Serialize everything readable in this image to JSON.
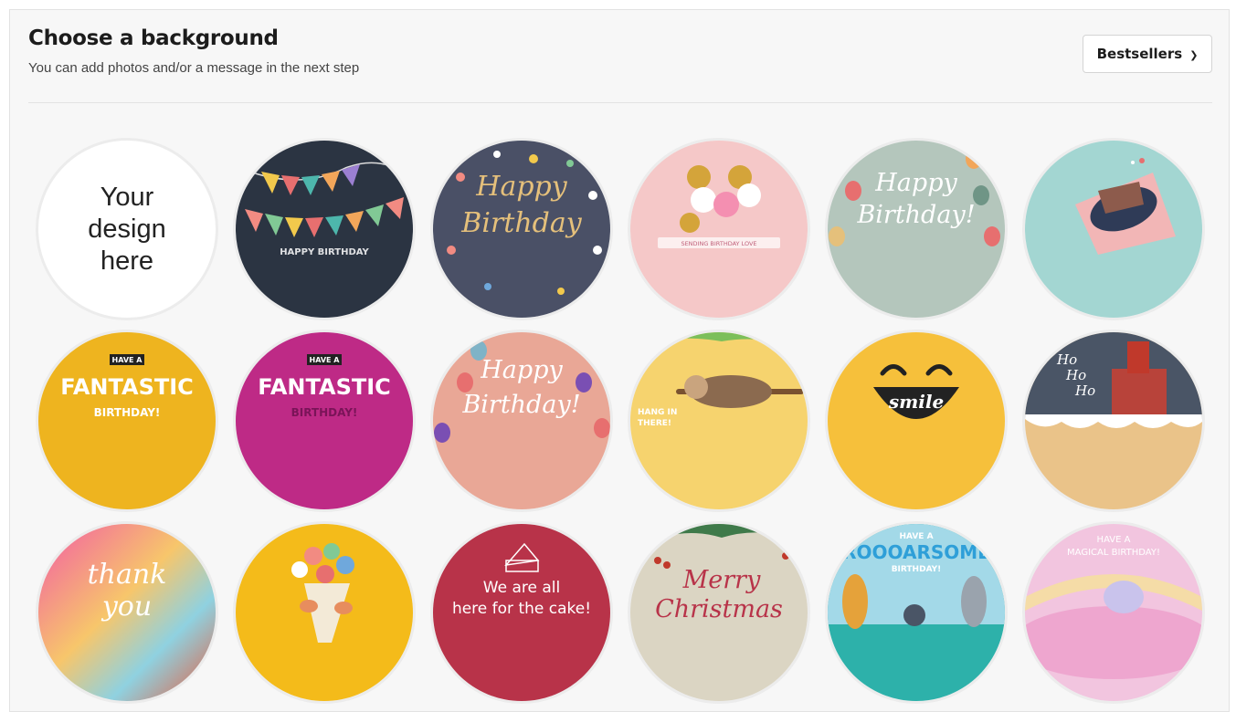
{
  "header": {
    "title": "Choose a background",
    "subtitle": "You can add photos and/or a message in the next step"
  },
  "sort": {
    "selected": "Bestsellers",
    "icon": "chevron-down-icon"
  },
  "designs": [
    {
      "id": "your-design",
      "lines": [
        "Your design",
        "here"
      ]
    },
    {
      "id": "happy-birthday-bunting",
      "text": "HAPPY BIRTHDAY",
      "color": "#2b3442"
    },
    {
      "id": "happy-birthday-navy",
      "lines": [
        "Happy",
        "Birthday"
      ],
      "color": "#4a5066"
    },
    {
      "id": "sending-birthday-love",
      "text": "SENDING BIRTHDAY LOVE",
      "color": "#f5c8c8"
    },
    {
      "id": "happy-birthday-sage",
      "lines": [
        "Happy",
        "Birthday!"
      ],
      "color": "#b4c6bc"
    },
    {
      "id": "cake-slice",
      "color": "#a3d6d2"
    },
    {
      "id": "fantastic-birthday-yellow",
      "lines": [
        "HAVE A",
        "FANTASTIC",
        "BIRTHDAY!"
      ],
      "color": "#eeb41f"
    },
    {
      "id": "fantastic-birthday-magenta",
      "lines": [
        "HAVE A",
        "FANTASTIC",
        "BIRTHDAY!"
      ],
      "color": "#be2a86"
    },
    {
      "id": "happy-birthday-peach",
      "lines": [
        "Happy",
        "Birthday!"
      ],
      "color": "#e9a796"
    },
    {
      "id": "hang-in-there-sloth",
      "lines": [
        "HANG IN",
        "THERE!"
      ],
      "color": "#f6d36e"
    },
    {
      "id": "smile",
      "text": "smile",
      "color": "#f6c03b"
    },
    {
      "id": "ho-ho-ho",
      "lines": [
        "Ho",
        "Ho",
        "Ho"
      ],
      "color": "#eac389"
    },
    {
      "id": "thank-you",
      "lines": [
        "thank",
        "you"
      ],
      "color": "#e8738c"
    },
    {
      "id": "flower-bouquet",
      "color": "#f4bb1a"
    },
    {
      "id": "here-for-the-cake",
      "lines": [
        "We are all",
        "here for the cake!"
      ],
      "color": "#b83349"
    },
    {
      "id": "merry-christmas",
      "lines": [
        "Merry",
        "Christmas"
      ],
      "color": "#dbd5c3"
    },
    {
      "id": "rooarsome-birthday",
      "lines": [
        "HAVE A",
        "ROOOARSOME",
        "BIRTHDAY!"
      ],
      "color": "#2db1aa"
    },
    {
      "id": "magical-birthday",
      "lines": [
        "HAVE A",
        "MAGICAL BIRTHDAY!"
      ],
      "color": "#f2c5df"
    }
  ]
}
